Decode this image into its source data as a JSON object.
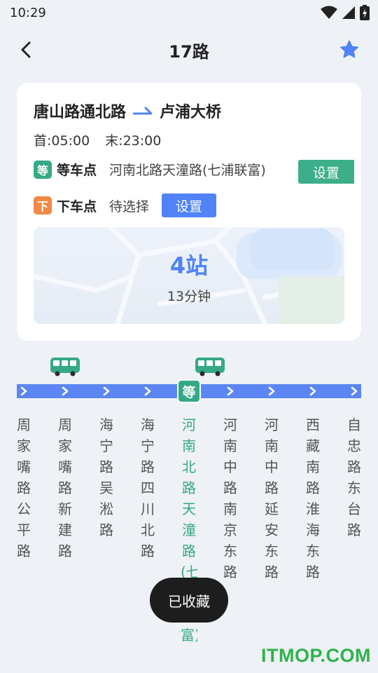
{
  "status": {
    "time": "10:29"
  },
  "header": {
    "title": "17路"
  },
  "route": {
    "from": "唐山路通北路",
    "to": "卢浦大桥",
    "first_label": "首:",
    "first_time": "05:00",
    "last_label": "末:",
    "last_time": "23:00"
  },
  "wait_stop": {
    "tag": "等",
    "label": "等车点",
    "value": "河南北路天潼路(七浦联富)",
    "button": "设置"
  },
  "alight_stop": {
    "tag": "下",
    "label": "下车点",
    "value": "待选择",
    "button": "设置"
  },
  "summary": {
    "stops": "4站",
    "duration": "13分钟"
  },
  "line": {
    "marker": "等",
    "stops": [
      "周家嘴路公平路",
      "周家嘴路新建路",
      "海宁路吴淞路",
      "海宁路四川北路",
      "河南北路天潼路(七浦联富)",
      "河南中路南京东路",
      "河南中路延安东路",
      "西藏南路淮海东路",
      "自忠路东台路"
    ]
  },
  "toast": "已收藏",
  "watermark": "ITMOP.COM",
  "colors": {
    "accent_blue": "#4f83f7",
    "wait_green": "#35a985",
    "alight_orange": "#f08a46",
    "line_blue": "#5b86f3"
  },
  "icons": {
    "back": "chevron-left-icon",
    "favorite": "star-icon",
    "bus": "bus-icon",
    "direction": "arrow-right-icon"
  }
}
